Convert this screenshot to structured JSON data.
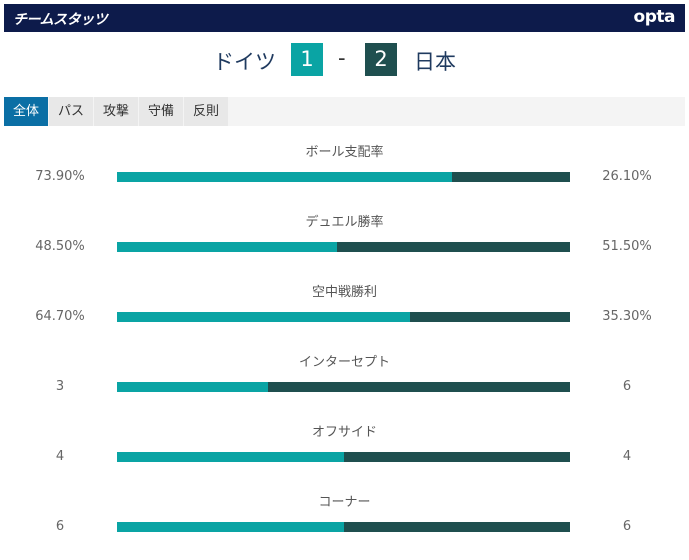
{
  "header": {
    "title": "チームスタッツ",
    "logo": "opta"
  },
  "match": {
    "home_team": "ドイツ",
    "home_score": "1",
    "separator": "-",
    "away_score": "2",
    "away_team": "日本"
  },
  "tabs": [
    {
      "label": "全体",
      "active": true
    },
    {
      "label": "パス",
      "active": false
    },
    {
      "label": "攻撃",
      "active": false
    },
    {
      "label": "守備",
      "active": false
    },
    {
      "label": "反則",
      "active": false
    }
  ],
  "colors": {
    "header_bg": "#0d1b4b",
    "home": "#0aa4a4",
    "away": "#1f4f4f",
    "tab_active": "#0b6fa5"
  },
  "stats": [
    {
      "label": "ボール支配率",
      "home": "73.90%",
      "away": "26.10%",
      "home_share": 0.739
    },
    {
      "label": "デュエル勝率",
      "home": "48.50%",
      "away": "51.50%",
      "home_share": 0.485
    },
    {
      "label": "空中戦勝利",
      "home": "64.70%",
      "away": "35.30%",
      "home_share": 0.647
    },
    {
      "label": "インターセプト",
      "home": "3",
      "away": "6",
      "home_share": 0.3333
    },
    {
      "label": "オフサイド",
      "home": "4",
      "away": "4",
      "home_share": 0.5
    },
    {
      "label": "コーナー",
      "home": "6",
      "away": "6",
      "home_share": 0.5
    }
  ]
}
